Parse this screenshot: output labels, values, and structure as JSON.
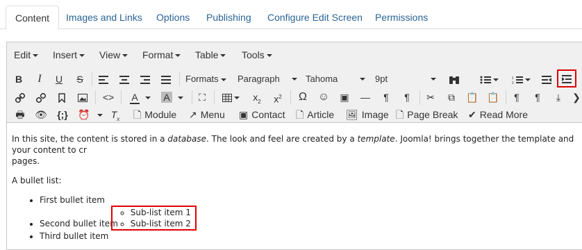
{
  "tabs": [
    {
      "label": "Content",
      "active": true
    },
    {
      "label": "Images and Links"
    },
    {
      "label": "Options"
    },
    {
      "label": "Publishing"
    },
    {
      "label": "Configure Edit Screen"
    },
    {
      "label": "Permissions"
    }
  ],
  "menubar": [
    "Edit",
    "Insert",
    "View",
    "Format",
    "Table",
    "Tools"
  ],
  "toolbar": {
    "formats": "Formats",
    "paragraph": "Paragraph",
    "font": "Tahoma",
    "size": "9pt",
    "module": "Module",
    "menu": "Menu",
    "contact": "Contact",
    "article": "Article",
    "image": "Image",
    "page_break": "Page Break",
    "read_more": "Read More",
    "code_label": "{;}"
  },
  "content": {
    "intro_before": "In this site, the content is stored in a ",
    "intro_em1": "database",
    "intro_mid": ". The look and feel are created by a ",
    "intro_em2": "template",
    "intro_after": ". Joomla! brings together the template and your content to cr",
    "intro_line2": "pages.",
    "bullet_heading": "A bullet list:",
    "items": [
      "First bullet item",
      "Second bullet item",
      "Third bullet item"
    ],
    "sub_items": [
      "Sub-list item 1",
      "Sub-list item 2"
    ]
  },
  "colors": {
    "highlight": "#e00000",
    "tab_link": "#2a6496"
  }
}
